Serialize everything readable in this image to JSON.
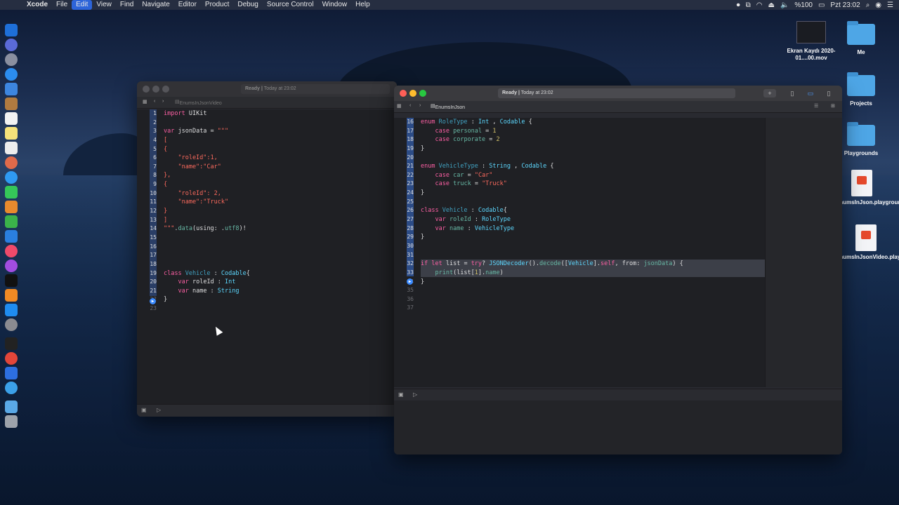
{
  "menubar": {
    "app": "Xcode",
    "items": [
      "File",
      "Edit",
      "View",
      "Find",
      "Navigate",
      "Editor",
      "Product",
      "Debug",
      "Source Control",
      "Window",
      "Help"
    ],
    "active_item": "Edit",
    "battery": "%100",
    "clock": "Pzt 23:02"
  },
  "desktop": {
    "icons": [
      {
        "label": "Ekran Kaydı 2020-01....00.mov",
        "kind": "video"
      },
      {
        "label": "Me",
        "kind": "folder"
      },
      {
        "label": "Projects",
        "kind": "folder"
      },
      {
        "label": "Playgrounds",
        "kind": "folder"
      },
      {
        "label": "EnumsInJson.playground",
        "kind": "playground"
      },
      {
        "label": "EnumsInJsonVideo.playground",
        "kind": "playground"
      }
    ]
  },
  "left_window": {
    "status": "Ready | Today at 23:02",
    "status_ready": "Ready |",
    "status_time": "Today at 23:02",
    "file": "EnumsInJsonVideo",
    "lines": [
      {
        "n": "1",
        "html": "<span class='kw'>import</span> <span class='plain'>UIKit</span>"
      },
      {
        "n": "2",
        "html": ""
      },
      {
        "n": "3",
        "html": "<span class='kw'>var</span> <span class='plain'>jsonData = </span><span class='str'>\"\"\"</span>"
      },
      {
        "n": "4",
        "html": "<span class='str'>[</span>"
      },
      {
        "n": "5",
        "html": "<span class='str'>{</span>"
      },
      {
        "n": "6",
        "html": "<span class='str'>    \"roleId\":1,</span>"
      },
      {
        "n": "7",
        "html": "<span class='str'>    \"name\":\"Car\"</span>"
      },
      {
        "n": "8",
        "html": "<span class='str'>},</span>"
      },
      {
        "n": "9",
        "html": "<span class='str'>{</span>"
      },
      {
        "n": "10",
        "html": "<span class='str'>    \"roleId\": 2,</span>"
      },
      {
        "n": "11",
        "html": "<span class='str'>    \"name\":\"Truck\"</span>"
      },
      {
        "n": "12",
        "html": "<span class='str'>}</span>"
      },
      {
        "n": "13",
        "html": "<span class='str'>]</span>"
      },
      {
        "n": "14",
        "html": "<span class='str'>\"\"\"</span><span class='plain'>.</span><span class='prop'>data</span><span class='plain'>(using: .</span><span class='prop'>utf8</span><span class='plain'>)!</span>"
      },
      {
        "n": "15",
        "html": ""
      },
      {
        "n": "16",
        "html": ""
      },
      {
        "n": "17",
        "html": ""
      },
      {
        "n": "18",
        "html": ""
      },
      {
        "n": "19",
        "html": "<span class='kw'>class</span> <span class='decl'>Vehicle</span> <span class='plain'>: </span><span class='typ'>Codable</span><span class='plain'>{</span>"
      },
      {
        "n": "20",
        "html": "<span class='plain'>    </span><span class='kw'>var</span> <span class='plain'>roleId : </span><span class='typ'>Int</span>"
      },
      {
        "n": "21",
        "html": "<span class='plain'>    </span><span class='kw'>var</span> <span class='plain'>name : </span><span class='typ'>String</span>"
      },
      {
        "n": "22",
        "html": "<span class='plain'>}</span>"
      },
      {
        "n": "23",
        "html": ""
      }
    ]
  },
  "right_window": {
    "status_ready": "Ready |",
    "status_time": "Today at 23:02",
    "file": "EnumsInJson",
    "lines": [
      {
        "n": "16",
        "html": "<span class='kw'>enum</span> <span class='decl'>RoleType</span> <span class='plain'>: </span><span class='typ'>Int</span> <span class='plain'>, </span><span class='typ'>Codable</span> <span class='plain'>{</span>"
      },
      {
        "n": "17",
        "html": "<span class='plain'>    </span><span class='kw'>case</span> <span class='prop'>personal</span> <span class='plain'>= </span><span class='num'>1</span>"
      },
      {
        "n": "18",
        "html": "<span class='plain'>    </span><span class='kw'>case</span> <span class='prop'>corporate</span> <span class='plain'>= </span><span class='num'>2</span>"
      },
      {
        "n": "19",
        "html": "<span class='plain'>}</span>"
      },
      {
        "n": "20",
        "html": ""
      },
      {
        "n": "21",
        "html": "<span class='kw'>enum</span> <span class='decl'>VehicleType</span> <span class='plain'>: </span><span class='typ'>String</span> <span class='plain'>, </span><span class='typ'>Codable</span> <span class='plain'>{</span>"
      },
      {
        "n": "22",
        "html": "<span class='plain'>    </span><span class='kw'>case</span> <span class='prop'>car</span> <span class='plain'>= </span><span class='str'>\"Car\"</span>"
      },
      {
        "n": "23",
        "html": "<span class='plain'>    </span><span class='kw'>case</span> <span class='prop'>truck</span> <span class='plain'>= </span><span class='str'>\"Truck\"</span>"
      },
      {
        "n": "24",
        "html": "<span class='plain'>}</span>"
      },
      {
        "n": "25",
        "html": ""
      },
      {
        "n": "26",
        "html": "<span class='kw'>class</span> <span class='decl'>Vehicle</span> <span class='plain'>: </span><span class='typ'>Codable</span><span class='plain'>{</span>"
      },
      {
        "n": "27",
        "html": "<span class='plain'>    </span><span class='kw'>var</span> <span class='prop'>roleId</span> <span class='plain'>: </span><span class='typ'>RoleType</span>"
      },
      {
        "n": "28",
        "html": "<span class='plain'>    </span><span class='kw'>var</span> <span class='prop'>name</span> <span class='plain'>: </span><span class='typ'>VehicleType</span>"
      },
      {
        "n": "29",
        "html": "<span class='plain'>}</span>"
      },
      {
        "n": "30",
        "html": ""
      },
      {
        "n": "31",
        "html": ""
      },
      {
        "n": "32",
        "html": "<span class='kw'>if</span> <span class='kw'>let</span> <span class='plain'>list = </span><span class='kw'>try</span><span class='plain'>? </span><span class='typ'>JSONDecoder</span><span class='plain'>().</span><span class='prop'>decode</span><span class='plain'>([</span><span class='typ'>Vehicle</span><span class='plain'>].</span><span class='kw'>self</span><span class='plain'>, from: </span><span class='prop'>jsonData</span><span class='plain'>) {</span>"
      },
      {
        "n": "33",
        "html": "<span class='plain'>    </span><span class='prop'>print</span><span class='plain'>(list[</span><span class='num'>1</span><span class='plain'>].</span><span class='prop'>name</span><span class='plain'>)</span>"
      },
      {
        "n": "34",
        "html": "<span class='plain'>}</span>"
      },
      {
        "n": "35",
        "html": ""
      },
      {
        "n": "36",
        "html": ""
      },
      {
        "n": "37",
        "html": ""
      }
    ]
  }
}
